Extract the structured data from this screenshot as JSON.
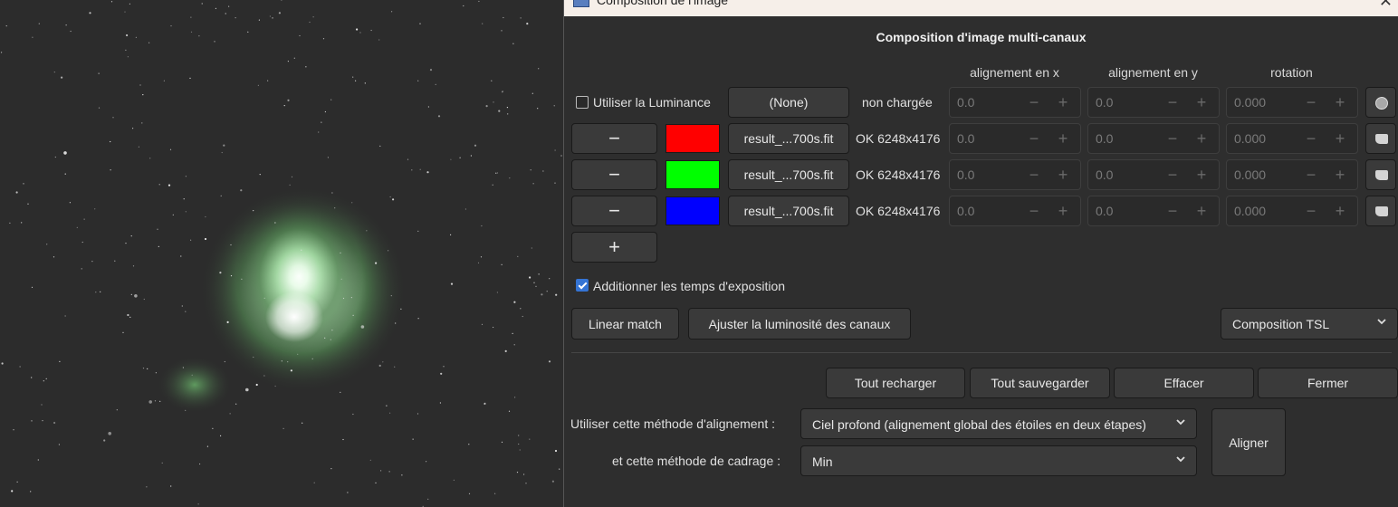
{
  "window": {
    "title": "Composition de l'image"
  },
  "dialog": {
    "heading": "Composition d'image multi-canaux",
    "columns": {
      "align_x": "alignement en x",
      "align_y": "alignement en y",
      "rotation": "rotation"
    },
    "luminance": {
      "checkbox_label": "Utiliser la Luminance",
      "checked": false,
      "file_button": "(None)",
      "status": "non chargée",
      "x": "0.0",
      "y": "0.0",
      "rot": "0.000"
    },
    "channels": [
      {
        "remove": "−",
        "color": "#ff0000",
        "file": "result_...700s.fit",
        "status": "OK 6248x4176",
        "x": "0.0",
        "y": "0.0",
        "rot": "0.000"
      },
      {
        "remove": "−",
        "color": "#00ff00",
        "file": "result_...700s.fit",
        "status": "OK 6248x4176",
        "x": "0.0",
        "y": "0.0",
        "rot": "0.000"
      },
      {
        "remove": "−",
        "color": "#0000ff",
        "file": "result_...700s.fit",
        "status": "OK 6248x4176",
        "x": "0.0",
        "y": "0.0",
        "rot": "0.000"
      }
    ],
    "spin_minus": "−",
    "spin_plus": "+",
    "add_button": "+",
    "sum_exposure": {
      "label": "Additionner les temps d'exposition",
      "checked": true
    },
    "linear_match": "Linear match",
    "adjust_brightness": "Ajuster la luminosité des canaux",
    "composition_mode": "Composition TSL",
    "actions": {
      "reload_all": "Tout recharger",
      "save_all": "Tout sauvegarder",
      "clear": "Effacer",
      "close": "Fermer"
    },
    "alignment": {
      "method_label": "Utiliser cette méthode d'alignement :",
      "method_value": "Ciel profond (alignement global des étoiles en deux étapes)",
      "framing_label": "et cette méthode de cadrage :",
      "framing_value": "Min",
      "align_button": "Aligner"
    }
  }
}
